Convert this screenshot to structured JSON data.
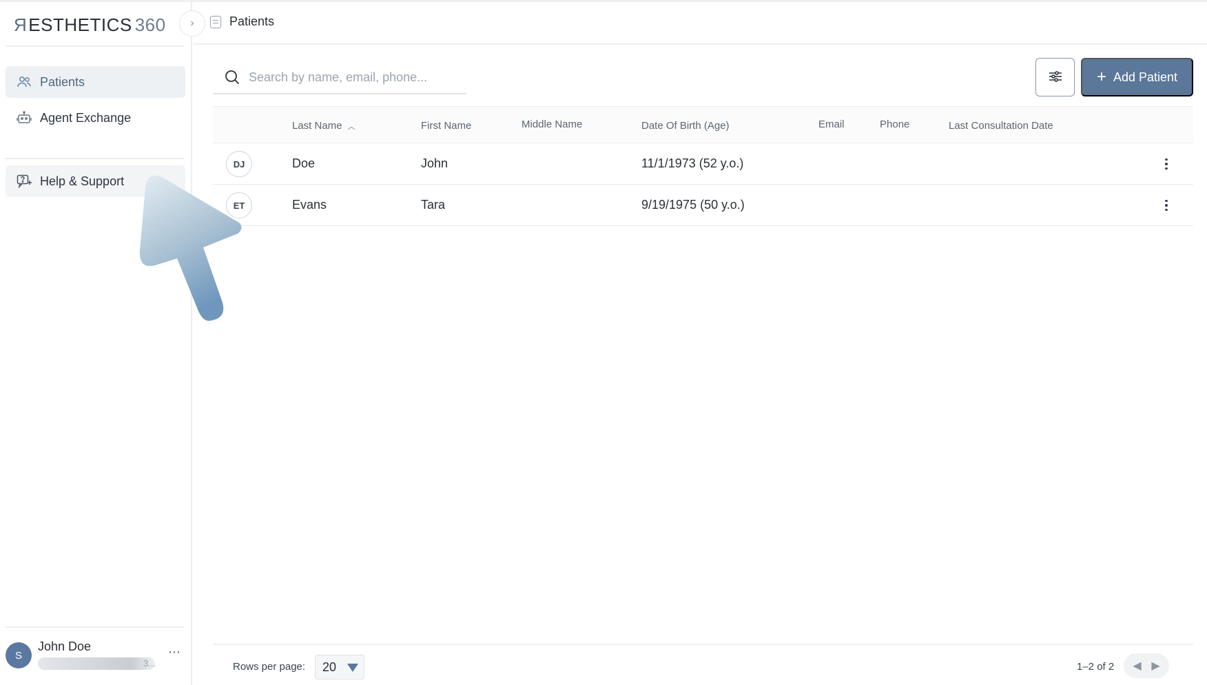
{
  "app": {
    "logo_mark": "Я",
    "logo_text": "ESTHETICS",
    "logo_suffix": "360"
  },
  "sidebar": {
    "items": [
      {
        "label": "Patients",
        "icon": "users-icon",
        "active": true
      },
      {
        "label": "Agent Exchange",
        "icon": "robot-icon",
        "active": false
      }
    ],
    "help_label": "Help & Support",
    "help_icon": "help-chat-icon",
    "user": {
      "initial": "S",
      "name": "John Doe",
      "email_tail": "3..."
    }
  },
  "header": {
    "breadcrumb": "Patients"
  },
  "toolbar": {
    "search_placeholder": "Search by name, email, phone...",
    "add_label": "Add Patient"
  },
  "table": {
    "columns": [
      "Last Name",
      "First Name",
      "Middle Name",
      "Date Of Birth (Age)",
      "Email",
      "Phone",
      "Last Consultation Date"
    ],
    "sorted_column": "Last Name",
    "sort_direction": "ascending",
    "rows": [
      {
        "initials": "DJ",
        "last": "Doe",
        "first": "John",
        "middle": "",
        "dob": "11/1/1973 (52 y.o.)",
        "email": "",
        "phone": "",
        "last_consult": ""
      },
      {
        "initials": "ET",
        "last": "Evans",
        "first": "Tara",
        "middle": "",
        "dob": "9/19/1975 (50 y.o.)",
        "email": "",
        "phone": "",
        "last_consult": ""
      }
    ]
  },
  "footer": {
    "rows_per_page_label": "Rows per page:",
    "rows_per_page": "20",
    "range": "1–2 of 2"
  },
  "colors": {
    "accent": "#5b7799",
    "active_nav_bg": "#eef1f4",
    "avatar": "#5a78a0"
  }
}
